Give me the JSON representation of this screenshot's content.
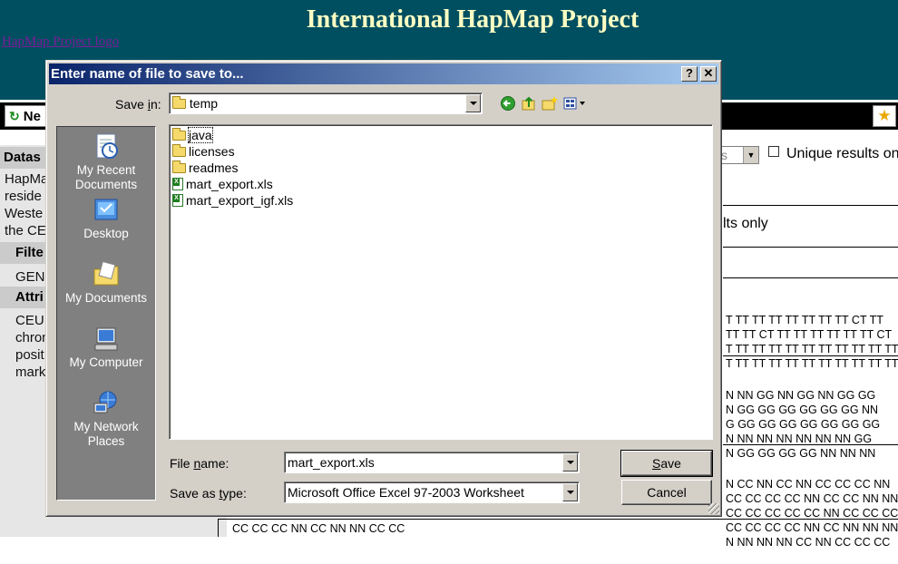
{
  "page": {
    "title": "International HapMap Project",
    "logo_alt": "HapMap Project logo",
    "toolbar": {
      "new_label": "Ne"
    },
    "left": {
      "dataset_header": "Datas",
      "dataset_text": [
        "HapMa",
        "reside",
        "Weste",
        "the CE"
      ],
      "filter_header": "Filte",
      "filter_text": "GEN",
      "attr_header": "Attri",
      "attr_text": [
        "CEU",
        "chron",
        "posit",
        "mark"
      ]
    },
    "right": {
      "select_value": "s",
      "unique_label": "Unique results only",
      "results_only": "lts only",
      "block1": [
        "T TT TT TT TT TT TT TT CT TT",
        "TT TT CT TT TT TT TT TT TT CT",
        "T TT TT TT TT TT TT TT TT TT TT",
        "T TT TT TT TT TT TT TT TT TT TT"
      ],
      "block2": [
        "N NN GG NN GG NN GG GG",
        "N GG GG GG GG GG GG NN",
        "G GG GG GG GG GG GG GG",
        "N NN NN NN NN NN NN GG",
        "N GG GG GG GG NN NN NN"
      ],
      "block3": [
        "N CC NN CC NN CC CC CC NN",
        "CC CC CC CC NN CC CC NN NN",
        "CC CC CC CC CC NN CC CC CC",
        "CC CC CC CC NN CC NN NN NN",
        "N NN NN NN CC NN CC CC CC"
      ],
      "bottom_row": "CC CC CC NN CC NN NN CC CC"
    }
  },
  "dialog": {
    "title": "Enter name of file to save to...",
    "help_btn": "?",
    "close_btn": "✕",
    "save_in_label_pre": "Save ",
    "save_in_label_u": "i",
    "save_in_label_post": "n:",
    "save_in_value": "temp",
    "places": [
      {
        "label": "My Recent Documents",
        "icon": "recent-documents-icon"
      },
      {
        "label": "Desktop",
        "icon": "desktop-icon"
      },
      {
        "label": "My Documents",
        "icon": "my-documents-icon"
      },
      {
        "label": "My Computer",
        "icon": "my-computer-icon"
      },
      {
        "label": "My Network Places",
        "icon": "network-places-icon"
      }
    ],
    "files": [
      {
        "name": "java",
        "type": "folder"
      },
      {
        "name": "licenses",
        "type": "folder"
      },
      {
        "name": "readmes",
        "type": "folder"
      },
      {
        "name": "mart_export.xls",
        "type": "xls"
      },
      {
        "name": "mart_export_igf.xls",
        "type": "xls"
      }
    ],
    "file_name_label_pre": "File ",
    "file_name_label_u": "n",
    "file_name_label_post": "ame:",
    "file_name_value": "mart_export.xls",
    "save_type_label_pre": "Save as ",
    "save_type_label_u": "t",
    "save_type_label_post": "ype:",
    "save_type_value": "Microsoft Office Excel 97-2003 Worksheet",
    "save_button_u": "S",
    "save_button_rest": "ave",
    "cancel_button": "Cancel",
    "colors": {
      "title_start": "#0a246a",
      "title_end": "#a6caf0",
      "face": "#d4d0c8"
    }
  }
}
